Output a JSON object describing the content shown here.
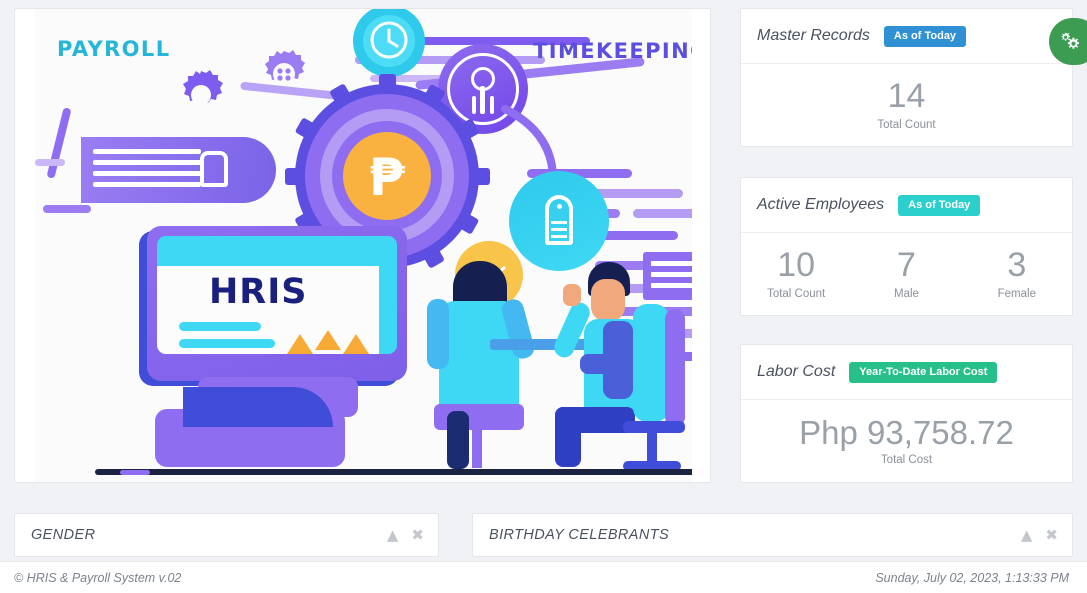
{
  "illustration": {
    "label_payroll": "PAYROLL",
    "label_timekeeping": "TIMEKEEPING",
    "screen_text": "HRIS",
    "currency_glyph": "₱"
  },
  "cards": [
    {
      "title": "Master Records",
      "badge": "As of Today",
      "badge_color": "#2f91d4",
      "metrics": [
        {
          "value": "14",
          "label": "Total Count"
        }
      ]
    },
    {
      "title": "Active Employees",
      "badge": "As of Today",
      "badge_color": "#2bd0cd",
      "metrics": [
        {
          "value": "10",
          "label": "Total Count"
        },
        {
          "value": "7",
          "label": "Male"
        },
        {
          "value": "3",
          "label": "Female"
        }
      ]
    },
    {
      "title": "Labor Cost",
      "badge": "Year-To-Date Labor Cost",
      "badge_color": "#27c08a",
      "metrics": [
        {
          "value": "Php 93,758.72",
          "label": "Total Cost"
        }
      ]
    }
  ],
  "settings_tab": {
    "icon": "cogs-icon",
    "color": "#3c9d52"
  },
  "panels": [
    {
      "title": "GENDER",
      "collapse_icon": "chevron-up-icon",
      "close_icon": "close-icon"
    },
    {
      "title": "BIRTHDAY CELEBRANTS",
      "collapse_icon": "chevron-up-icon",
      "close_icon": "close-icon"
    }
  ],
  "footer": {
    "copyright": "© HRIS & Payroll System v.02",
    "datetime": "Sunday, July 02, 2023, 1:13:33 PM"
  }
}
